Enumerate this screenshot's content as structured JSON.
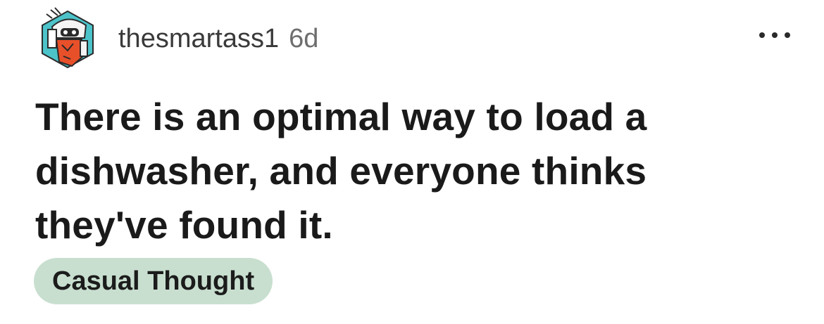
{
  "post": {
    "author": {
      "username": "thesmartass1",
      "avatar_icon": "robot-avatar-icon"
    },
    "age": "6d",
    "more_icon": "more-options-icon",
    "title": "There is an optimal way to load a dishwasher, and everyone thinks they've found it.",
    "flair": {
      "label": "Casual Thought",
      "background": "#c8dfcf"
    }
  },
  "colors": {
    "avatar_bg": "#4cc3c9",
    "avatar_accent": "#e8502a"
  }
}
